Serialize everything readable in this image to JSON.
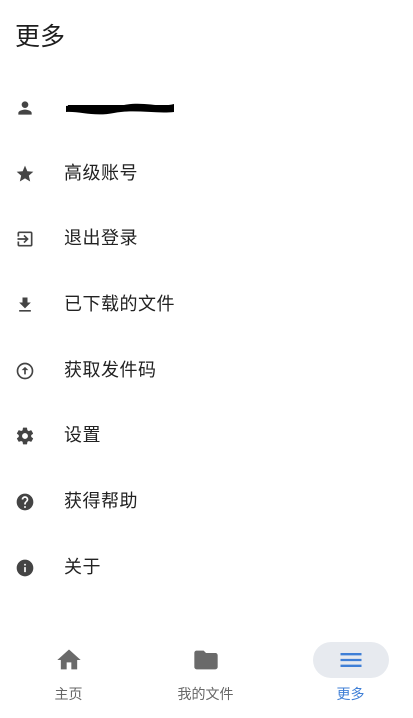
{
  "page": {
    "title": "更多"
  },
  "menu": {
    "account_name_redacted": true,
    "items": [
      {
        "label": "高级账号",
        "icon": "star-icon"
      },
      {
        "label": "退出登录",
        "icon": "logout-icon"
      },
      {
        "label": "已下载的文件",
        "icon": "download-icon"
      },
      {
        "label": "获取发件码",
        "icon": "upload-circle-icon"
      },
      {
        "label": "设置",
        "icon": "gear-icon"
      },
      {
        "label": "获得帮助",
        "icon": "help-icon"
      },
      {
        "label": "关于",
        "icon": "info-icon"
      }
    ]
  },
  "bottom_nav": {
    "tabs": [
      {
        "label": "主页",
        "icon": "home-icon",
        "active": false
      },
      {
        "label": "我的文件",
        "icon": "folder-icon",
        "active": false
      },
      {
        "label": "更多",
        "icon": "menu-icon",
        "active": true
      }
    ]
  },
  "colors": {
    "icon": "#444444",
    "text": "#222222",
    "accent": "#3f7fd6",
    "active_pill": "#e7eaef",
    "inactive_nav_icon": "#6a6a6a"
  }
}
